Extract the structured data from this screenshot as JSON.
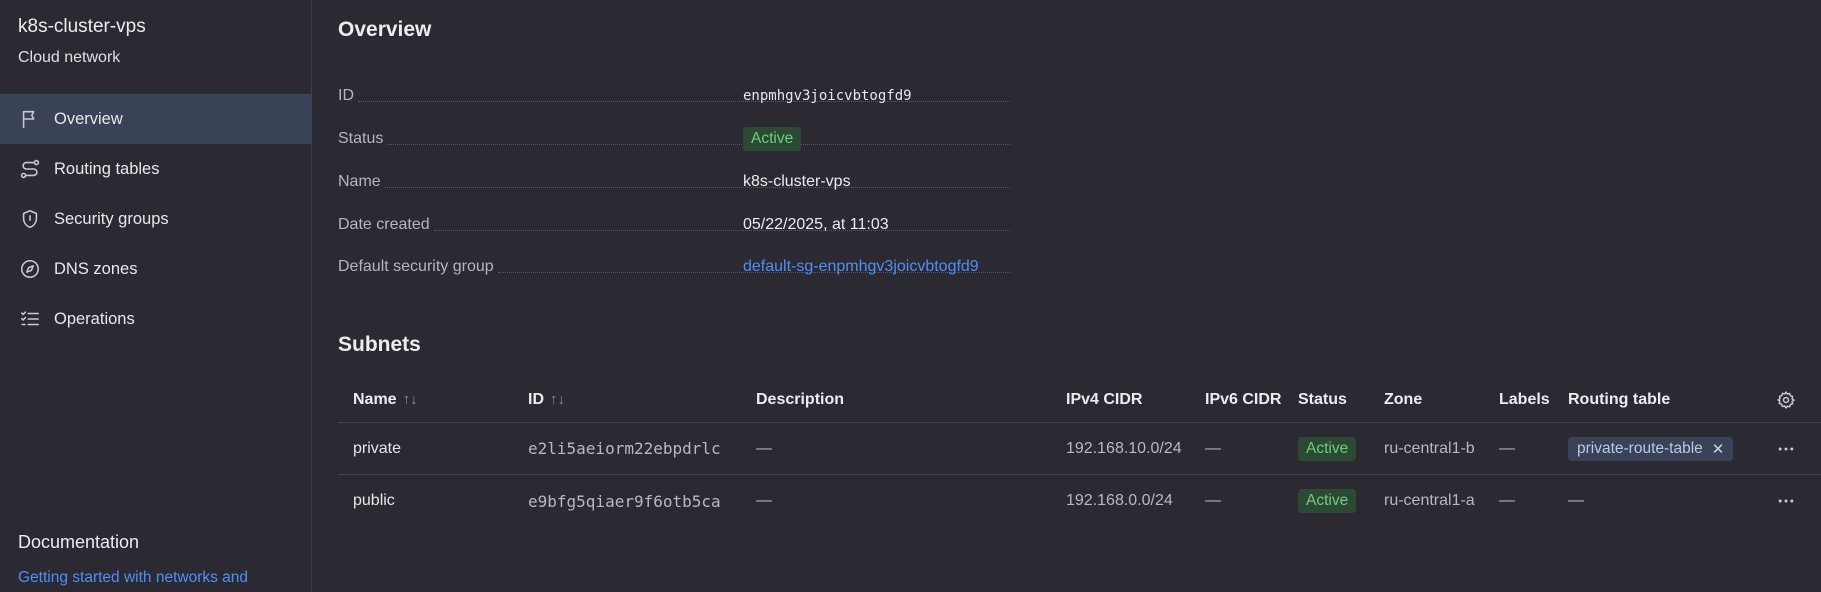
{
  "sidebar": {
    "title": "k8s-cluster-vps",
    "subtitle": "Cloud network",
    "items": [
      {
        "label": "Overview",
        "icon": "flag-icon",
        "active": true
      },
      {
        "label": "Routing tables",
        "icon": "route-icon",
        "active": false
      },
      {
        "label": "Security groups",
        "icon": "shield-icon",
        "active": false
      },
      {
        "label": "DNS zones",
        "icon": "compass-icon",
        "active": false
      },
      {
        "label": "Operations",
        "icon": "checklist-icon",
        "active": false
      }
    ],
    "documentation": {
      "title": "Documentation",
      "link": "Getting started with networks and"
    }
  },
  "overview": {
    "title": "Overview",
    "properties": {
      "id": {
        "label": "ID",
        "value": "enpmhgv3joicvbtogfd9"
      },
      "status": {
        "label": "Status",
        "value": "Active"
      },
      "name": {
        "label": "Name",
        "value": "k8s-cluster-vps"
      },
      "date_created": {
        "label": "Date created",
        "value": "05/22/2025, at 11:03"
      },
      "default_sg": {
        "label": "Default security group",
        "value": "default-sg-enpmhgv3joicvbtogfd9"
      }
    }
  },
  "subnets": {
    "title": "Subnets",
    "columns": {
      "name": "Name",
      "id": "ID",
      "description": "Description",
      "ipv4": "IPv4 CIDR",
      "ipv6": "IPv6 CIDR",
      "status": "Status",
      "zone": "Zone",
      "labels": "Labels",
      "routing_table": "Routing table"
    },
    "sort_icon": "sort-arrows-icon",
    "rows": [
      {
        "name": "private",
        "id": "e2li5aeiorm22ebpdrlc",
        "description": "—",
        "ipv4": "192.168.10.0/24",
        "ipv6": "—",
        "status": "Active",
        "zone": "ru-central1-b",
        "labels": "—",
        "routing_table": "private-route-table"
      },
      {
        "name": "public",
        "id": "e9bfg5qiaer9f6otb5ca",
        "description": "—",
        "ipv4": "192.168.0.0/24",
        "ipv6": "—",
        "status": "Active",
        "zone": "ru-central1-a",
        "labels": "—",
        "routing_table": "—"
      }
    ]
  },
  "colors": {
    "background": "#2b2a33",
    "active_nav": "#3a4258",
    "link": "#4f8ff5",
    "status_bg": "#2c4a33",
    "status_text": "#6fcc7c"
  }
}
